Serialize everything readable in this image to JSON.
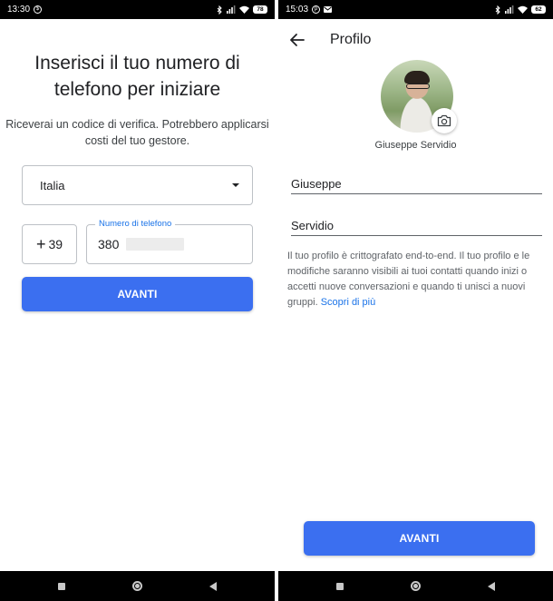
{
  "left": {
    "status": {
      "time": "13:30",
      "battery": "78"
    },
    "title": "Inserisci il tuo numero di telefono per iniziare",
    "subtitle": "Riceverai un codice di verifica. Potrebbero applicarsi costi del tuo gestore.",
    "country": {
      "value": "Italia"
    },
    "prefix": {
      "value": "39"
    },
    "phone": {
      "label": "Numero di telefono",
      "value": "380"
    },
    "button": "AVANTI"
  },
  "right": {
    "status": {
      "time": "15:03",
      "battery": "62"
    },
    "title": "Profilo",
    "profile_name": "Giuseppe Servidio",
    "first_name": "Giuseppe",
    "last_name": "Servidio",
    "info_text": "Il tuo profilo è crittografato end-to-end. Il tuo profilo e le modifiche saranno visibili ai tuoi contatti quando inizi o accetti nuove conversazioni e quando ti unisci a nuovi gruppi.",
    "info_link": "Scopri di più",
    "button": "AVANTI"
  },
  "colors": {
    "accent": "#3b6ff0",
    "link": "#1a73e8",
    "label": "#1a73e8"
  },
  "icons": [
    "bluetooth-icon",
    "signal-icon",
    "wifi-icon",
    "battery-icon",
    "arrow-back-icon",
    "camera-icon",
    "dropdown-icon",
    "recents-icon",
    "home-icon",
    "back-nav-icon"
  ]
}
